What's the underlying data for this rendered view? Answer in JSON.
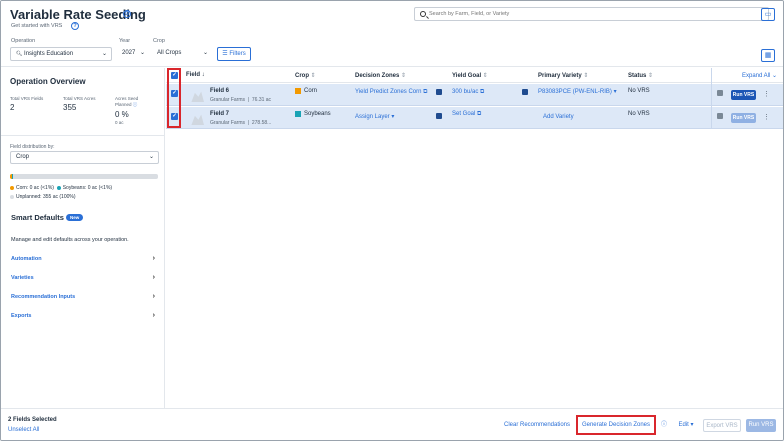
{
  "header": {
    "title": "Variable Rate Seeding",
    "subtitle": "Get started with VRS",
    "search_placeholder": "Search by Farm, Field, or Variety"
  },
  "filters": {
    "operation_label": "Operation",
    "operation_value": "Insights Education",
    "year_label": "Year",
    "year_value": "2027",
    "crop_label": "Crop",
    "crop_value": "All Crops",
    "filters_button": "Filters"
  },
  "overview": {
    "title": "Operation Overview",
    "stats": [
      {
        "label": "Total VRS Fields",
        "value": "2"
      },
      {
        "label": "Total VRS Acres",
        "value": "355"
      },
      {
        "label": "Acres Seed Planned",
        "value": "0 %",
        "sub": "0 ac"
      }
    ],
    "distribution_label": "Field distribution by:",
    "distribution_value": "Crop",
    "legend": {
      "corn": "Corn: 0 ac (<1%)",
      "soybeans": "Soybeans: 0 ac (<1%)",
      "unplanned": "Unplanned: 355 ac (100%)"
    },
    "colors": {
      "corn": "#f29900",
      "soybeans": "#1aa3b5",
      "unplanned": "#d9dde2"
    }
  },
  "smart_defaults": {
    "title": "Smart Defaults",
    "badge": "New",
    "description": "Manage and edit defaults across your operation.",
    "items": [
      "Automation",
      "Varieties",
      "Recommendation Inputs",
      "Exports"
    ]
  },
  "table": {
    "columns": [
      "Field",
      "Crop",
      "Decision Zones",
      "Yield Goal",
      "Primary Variety",
      "Status"
    ],
    "expand_all": "Expand All",
    "rows": [
      {
        "field": "Field 6",
        "farm": "Granular Farms",
        "acres": "76.31 ac",
        "crop": "Corn",
        "crop_color": "#f29900",
        "decision_zone": "Yield Predict Zones Corn",
        "yield_goal": "300 bu/ac",
        "variety": "P83083PCE (PW-ENL-RIB)",
        "status": "No VRS",
        "run": "Run VRS"
      },
      {
        "field": "Field 7",
        "farm": "Granular Farms",
        "acres": "278.58...",
        "crop": "Soybeans",
        "crop_color": "#1aa3b5",
        "decision_zone": "Assign Layer",
        "yield_goal": "Set Goal",
        "variety": "Add Variety",
        "status": "No VRS",
        "run": "Run VRS"
      }
    ]
  },
  "footer": {
    "selected": "2 Fields Selected",
    "unselect": "Unselect All",
    "clear": "Clear Recommendations",
    "generate": "Generate Decision Zones",
    "edit": "Edit",
    "export": "Export VRS",
    "run": "Run VRS"
  },
  "accent": "#2a6fd6",
  "highlight": "#d9262c"
}
